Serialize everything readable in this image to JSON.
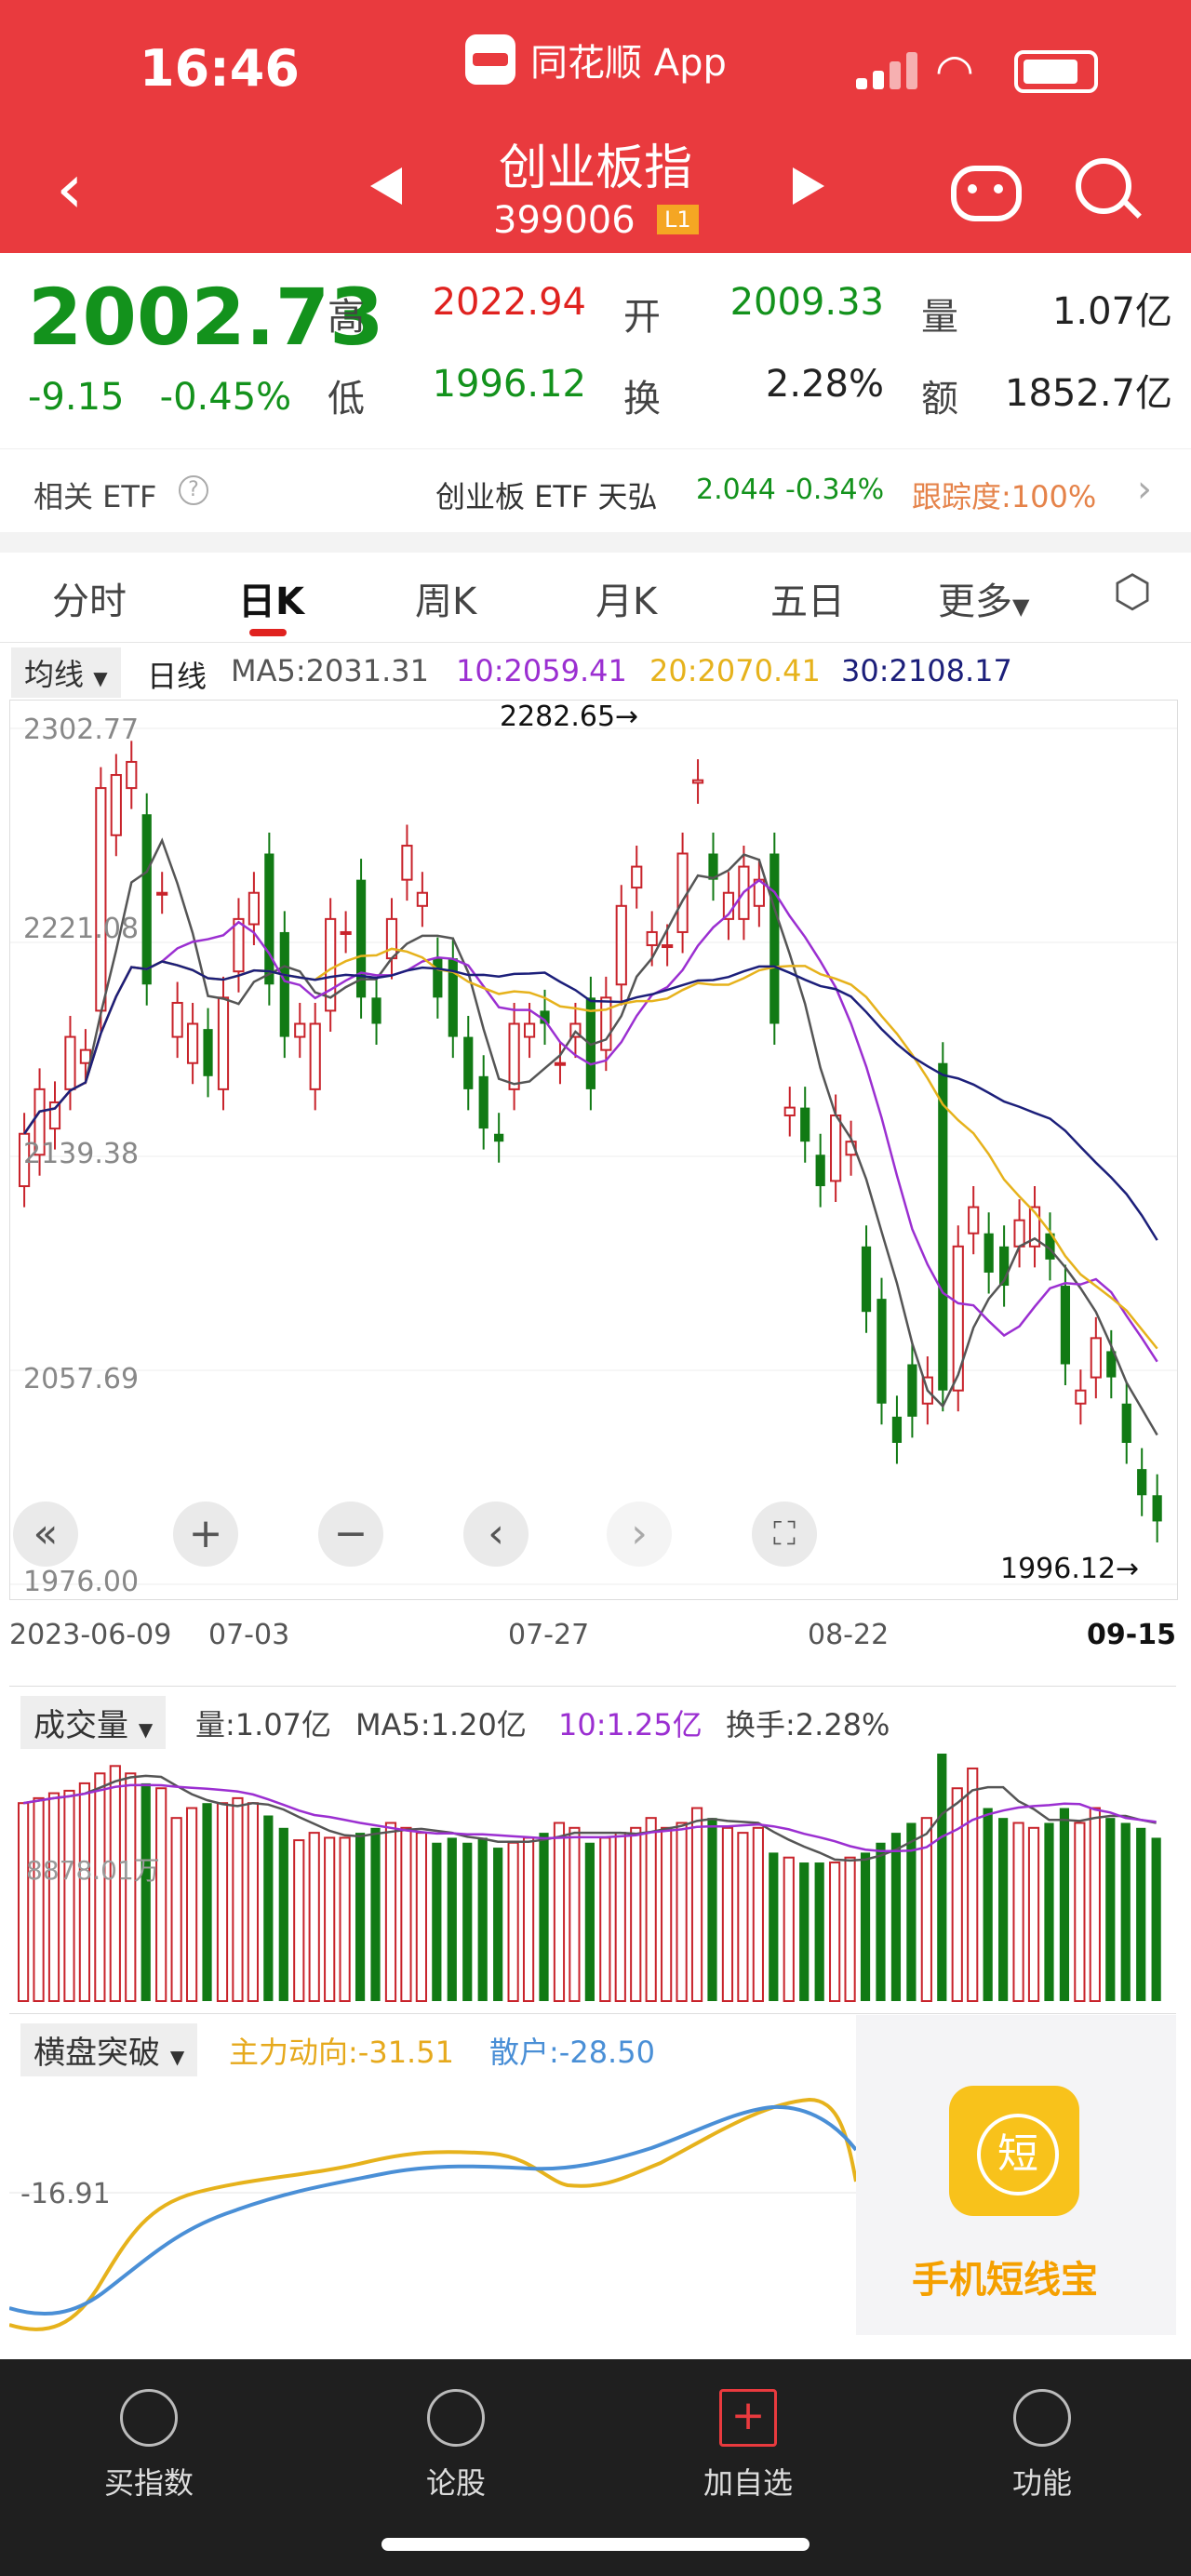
{
  "status_bar": {
    "time": "16:46",
    "app": "同花顺 App"
  },
  "header": {
    "title": "创业板指",
    "code": "399006",
    "level": "L1"
  },
  "quote": {
    "price": "2002.73",
    "change": "-9.15",
    "change_pct": "-0.45%",
    "high_label": "高",
    "high": "2022.94",
    "open_label": "开",
    "open": "2009.33",
    "volume_label": "量",
    "volume": "1.07亿",
    "low_label": "低",
    "low": "1996.12",
    "turnover_label": "换",
    "turnover": "2.28%",
    "amount_label": "额",
    "amount": "1852.7亿"
  },
  "etf": {
    "label": "相关 ETF",
    "name": "创业板 ETF 天弘",
    "price": "2.044",
    "change": "-0.34%",
    "tracking": "跟踪度:100%"
  },
  "tabs": [
    "分时",
    "日K",
    "周K",
    "月K",
    "五日",
    "更多"
  ],
  "ma_row": {
    "type_label": "均线",
    "period": "日线",
    "ma5": "MA5:2031.31",
    "ma10": "10:2059.41",
    "ma20": "20:2070.41",
    "ma30": "30:2108.17"
  },
  "chart": {
    "y_labels": [
      "2302.77",
      "2221.08",
      "2139.38",
      "2057.69",
      "1976.00"
    ],
    "max_label": "2282.65→",
    "min_label": "1996.12→",
    "dates": [
      "2023-06-09",
      "07-03",
      "07-27",
      "08-22",
      "09-15"
    ],
    "colors": {
      "up": "#c8232b",
      "down": "#117a14",
      "ma5": "#555555",
      "ma10": "#9b2fd1",
      "ma20": "#e6b21c",
      "ma30": "#1c1f7a"
    }
  },
  "chart_data": {
    "type": "candlestick",
    "ylim": [
      1976.0,
      2302.77
    ],
    "candles": [
      [
        2128,
        2148
      ],
      [
        2140,
        2165
      ],
      [
        2150,
        2160
      ],
      [
        2165,
        2185
      ],
      [
        2175,
        2180
      ],
      [
        2195,
        2280
      ],
      [
        2262,
        2285
      ],
      [
        2280,
        2290
      ],
      [
        2270,
        2205
      ],
      [
        2240,
        2240
      ],
      [
        2185,
        2198
      ],
      [
        2175,
        2190
      ],
      [
        2188,
        2170
      ],
      [
        2165,
        2200
      ],
      [
        2210,
        2230
      ],
      [
        2228,
        2240
      ],
      [
        2255,
        2205
      ],
      [
        2225,
        2185
      ],
      [
        2185,
        2190
      ],
      [
        2165,
        2190
      ],
      [
        2195,
        2230
      ],
      [
        2225,
        2225
      ],
      [
        2245,
        2200
      ],
      [
        2200,
        2190
      ],
      [
        2215,
        2230
      ],
      [
        2245,
        2258
      ],
      [
        2235,
        2240
      ],
      [
        2215,
        2200
      ],
      [
        2215,
        2185
      ],
      [
        2185,
        2165
      ],
      [
        2170,
        2150
      ],
      [
        2148,
        2145
      ],
      [
        2165,
        2190
      ],
      [
        2185,
        2190
      ],
      [
        2195,
        2190
      ],
      [
        2175,
        2175
      ],
      [
        2185,
        2190
      ],
      [
        2200,
        2165
      ],
      [
        2180,
        2200
      ],
      [
        2205,
        2235
      ],
      [
        2242,
        2250
      ],
      [
        2220,
        2225
      ],
      [
        2220,
        2220
      ],
      [
        2225,
        2255
      ],
      [
        2282,
        2283
      ],
      [
        2255,
        2245
      ],
      [
        2230,
        2240
      ],
      [
        2230,
        2250
      ],
      [
        2235,
        2245
      ],
      [
        2255,
        2190
      ],
      [
        2155,
        2158
      ],
      [
        2158,
        2145
      ],
      [
        2140,
        2128
      ],
      [
        2130,
        2155
      ],
      [
        2140,
        2145
      ],
      [
        2105,
        2080
      ],
      [
        2085,
        2045
      ],
      [
        2040,
        2030
      ],
      [
        2060,
        2040
      ],
      [
        2045,
        2055
      ],
      [
        2175,
        2050
      ],
      [
        2050,
        2105
      ],
      [
        2110,
        2120
      ],
      [
        2110,
        2095
      ],
      [
        2105,
        2090
      ],
      [
        2105,
        2115
      ],
      [
        2105,
        2120
      ],
      [
        2110,
        2100
      ],
      [
        2090,
        2060
      ],
      [
        2045,
        2050
      ],
      [
        2055,
        2070
      ],
      [
        2065,
        2055
      ],
      [
        2045,
        2030
      ],
      [
        2020,
        2010
      ],
      [
        2010,
        2000
      ]
    ],
    "volume_pct": [
      0.8,
      0.82,
      0.84,
      0.85,
      0.88,
      0.92,
      0.95,
      0.92,
      0.88,
      0.86,
      0.74,
      0.78,
      0.8,
      0.8,
      0.82,
      0.8,
      0.75,
      0.7,
      0.65,
      0.68,
      0.66,
      0.66,
      0.68,
      0.7,
      0.72,
      0.7,
      0.68,
      0.64,
      0.66,
      0.64,
      0.66,
      0.62,
      0.64,
      0.66,
      0.68,
      0.72,
      0.7,
      0.64,
      0.66,
      0.68,
      0.7,
      0.74,
      0.7,
      0.72,
      0.78,
      0.74,
      0.7,
      0.68,
      0.7,
      0.6,
      0.58,
      0.56,
      0.56,
      0.56,
      0.58,
      0.6,
      0.64,
      0.68,
      0.72,
      0.74,
      1.0,
      0.86,
      0.94,
      0.78,
      0.74,
      0.72,
      0.7,
      0.72,
      0.78,
      0.72,
      0.78,
      0.74,
      0.72,
      0.7,
      0.66
    ]
  },
  "volume_panel": {
    "type_label": "成交量",
    "vol": "量:1.07亿",
    "ma5": "MA5:1.20亿",
    "ma10": "10:1.25亿",
    "turnover": "换手:2.28%",
    "axis": "8878.01万"
  },
  "indicator_panel": {
    "type_label": "横盘突破",
    "main": "主力动向:-31.51",
    "retail": "散户:-28.50",
    "axis": "-16.91"
  },
  "ad": {
    "glyph": "短",
    "text": "手机短线宝"
  },
  "bottom_nav": [
    "买指数",
    "论股",
    "加自选",
    "功能"
  ]
}
